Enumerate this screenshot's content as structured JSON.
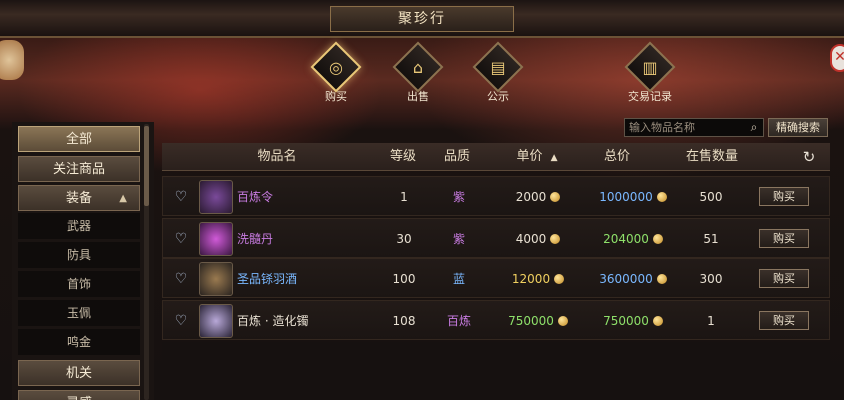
{
  "window": {
    "title": "聚珍行"
  },
  "tabs": [
    {
      "label": "购买",
      "icon": "coin-icon",
      "glyph": "◎"
    },
    {
      "label": "出售",
      "icon": "stall-icon",
      "glyph": "⌂"
    },
    {
      "label": "公示",
      "icon": "scroll-icon",
      "glyph": "▤"
    },
    {
      "label": "交易记录",
      "icon": "book-icon",
      "glyph": "▥"
    }
  ],
  "sidebar": {
    "items": [
      {
        "label": "全部"
      },
      {
        "label": "关注商品"
      },
      {
        "label": "装备"
      },
      {
        "label": "武器"
      },
      {
        "label": "防具"
      },
      {
        "label": "首饰"
      },
      {
        "label": "玉佩"
      },
      {
        "label": "鸣金"
      },
      {
        "label": "机关"
      },
      {
        "label": "灵感"
      }
    ]
  },
  "search": {
    "placeholder": "输入物品名称",
    "exact_label": "精确搜索"
  },
  "table": {
    "headers": [
      "物品名",
      "等级",
      "品质",
      "单价",
      "总价",
      "在售数量"
    ],
    "sort_indicator": "▲",
    "rows": [
      {
        "name": "百炼令",
        "level": "1",
        "quality": "紫",
        "unit_price": "2000",
        "total_price": "1000000",
        "stock": "500",
        "buy": "购买"
      },
      {
        "name": "洗髓丹",
        "level": "30",
        "quality": "紫",
        "unit_price": "4000",
        "total_price": "204000",
        "stock": "51",
        "buy": "购买"
      },
      {
        "name": "圣品铩羽酒",
        "level": "100",
        "quality": "蓝",
        "unit_price": "12000",
        "total_price": "3600000",
        "stock": "300",
        "buy": "购买"
      },
      {
        "name": "百炼 · 造化镯",
        "level": "108",
        "quality": "百炼",
        "unit_price": "750000",
        "total_price": "750000",
        "stock": "1",
        "buy": "购买"
      }
    ]
  },
  "colors": {
    "purple": "#c77be0",
    "blue": "#7ab8ff",
    "yellow": "#f0d060",
    "green": "#8ee06a",
    "white": "#e8e0d2",
    "accent_gold": "#e9c878"
  }
}
